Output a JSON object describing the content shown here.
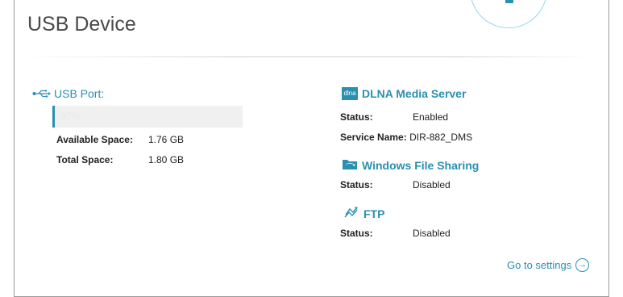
{
  "page": {
    "title": "USB Device"
  },
  "usb": {
    "label": "USB Port:",
    "usage_text": "97%",
    "usage_fraction": 0.97,
    "available_label": "Available Space:",
    "available_value": "1.76 GB",
    "total_label": "Total Space:",
    "total_value": "1.80 GB"
  },
  "dlna": {
    "icon_text": "dlna",
    "title": "DLNA Media Server",
    "status_label": "Status:",
    "status_value": "Enabled",
    "service_name_label": "Service Name:",
    "service_name_value": "DIR-882_DMS"
  },
  "smb": {
    "title": "Windows File Sharing",
    "status_label": "Status:",
    "status_value": "Disabled"
  },
  "ftp": {
    "title": "FTP",
    "status_label": "Status:",
    "status_value": "Disabled"
  },
  "settings_link": "Go to settings",
  "colors": {
    "accent": "#2a8fb0",
    "text": "#222222",
    "title": "#4a4a4a"
  },
  "icons": [
    "usb-icon",
    "dlna-icon",
    "folder-icon",
    "ftp-icon",
    "arrow-right-circle-icon"
  ]
}
